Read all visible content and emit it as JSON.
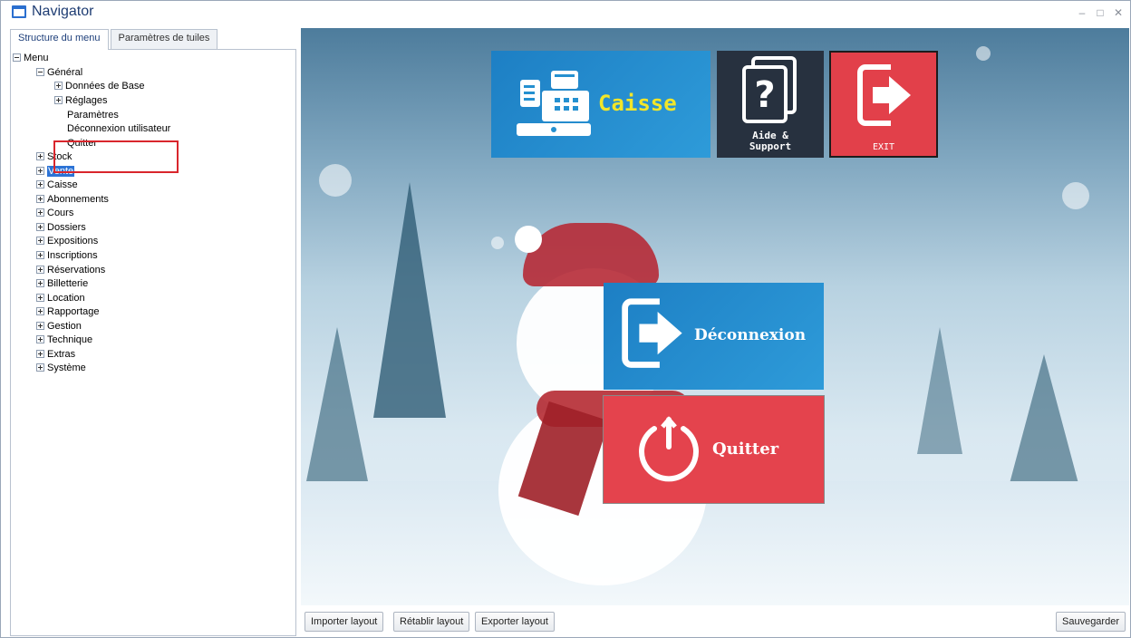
{
  "window": {
    "title": "Navigator",
    "controls": [
      "–",
      "□",
      "✕"
    ]
  },
  "tabs": [
    "Structure du menu",
    "Paramètres de tuiles"
  ],
  "tree": {
    "root": "Menu",
    "general": "Général",
    "general_children": [
      "Données de Base",
      "Réglages",
      "Paramètres",
      "Déconnexion utilisateur",
      "Quitter"
    ],
    "sections": [
      "Stock",
      "Vente",
      "Caisse",
      "Abonnements",
      "Cours",
      "Dossiers",
      "Expositions",
      "Inscriptions",
      "Réservations",
      "Billetterie",
      "Location",
      "Rapportage",
      "Gestion",
      "Technique",
      "Extras",
      "Système"
    ],
    "selected": "Vente"
  },
  "tiles": {
    "caisse": "Caisse",
    "aide_line1": "Aide &",
    "aide_line2": "Support",
    "exit": "EXIT",
    "deconnexion": "Déconnexion",
    "quitter": "Quitter"
  },
  "buttons": {
    "import": "Importer layout",
    "reset": "Rétablir layout",
    "export": "Exporter layout",
    "save": "Sauvegarder"
  },
  "colors": {
    "tile_blue": "#2590d0",
    "tile_red": "#e4434d",
    "tile_dark": "#27313f",
    "caisse_text": "#f2e629",
    "highlight_red": "#d9262c"
  },
  "icons": [
    "window-icon",
    "cash-register-icon",
    "help-document-icon",
    "exit-arrow-icon",
    "logout-arrow-icon",
    "power-icon"
  ]
}
